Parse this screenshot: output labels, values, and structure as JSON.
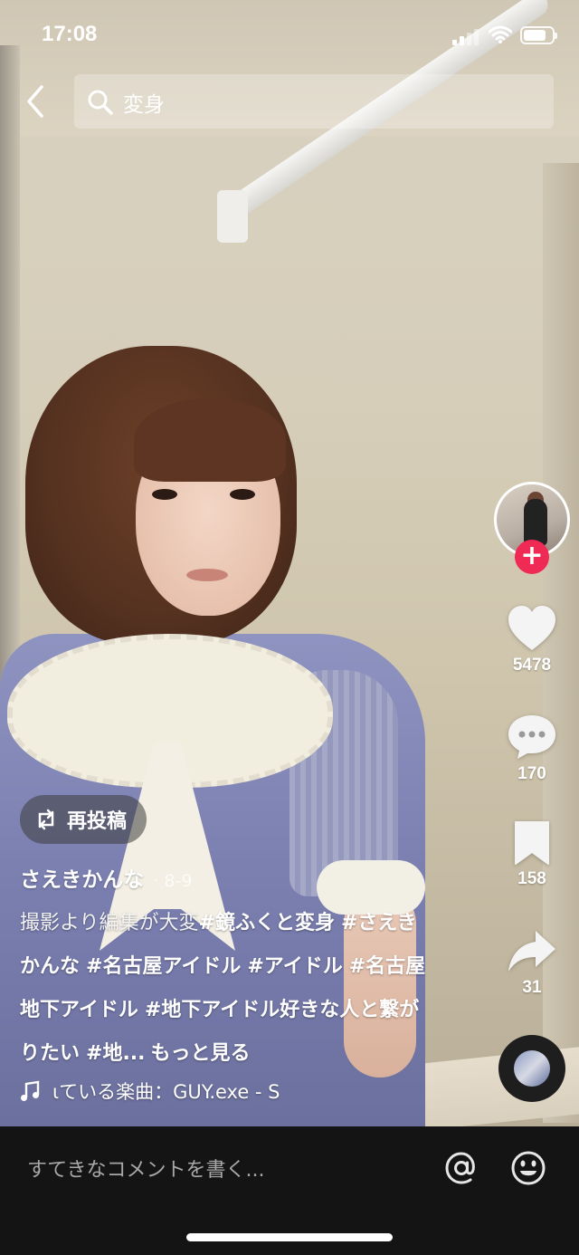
{
  "status_bar": {
    "time": "17:08"
  },
  "search": {
    "query": "変身"
  },
  "creator": {
    "repost_label": "再投稿",
    "username": "さえきかんな",
    "date": "· 8-9"
  },
  "caption": {
    "text": "撮影より編集が大変",
    "hashtags": [
      "#鏡ふくと変身",
      "#さえきかんな",
      "#名古屋アイドル",
      "#アイドル",
      "#名古屋地下アイドル",
      "#地下アイドル好きな人と繋がりたい",
      "#地..."
    ],
    "more_label": "もっと見る"
  },
  "sound": {
    "label": "ιている楽曲：GUY.exe - S"
  },
  "actions": {
    "likes": "5478",
    "comments": "170",
    "saves": "158",
    "shares": "31",
    "follow": "+"
  },
  "comment_bar": {
    "placeholder": "すてきなコメントを書く..."
  },
  "icons": {
    "back": "chevron-left-icon",
    "search": "search-icon",
    "like": "heart-icon",
    "comment": "comment-bubble-icon",
    "save": "bookmark-icon",
    "share": "share-arrow-icon",
    "repost": "repost-icon",
    "music": "music-note-icon",
    "mention": "at-sign-icon",
    "emoji": "emoji-icon"
  },
  "colors": {
    "follow_accent": "#ee2a55",
    "comment_bar_bg": "#141414"
  }
}
